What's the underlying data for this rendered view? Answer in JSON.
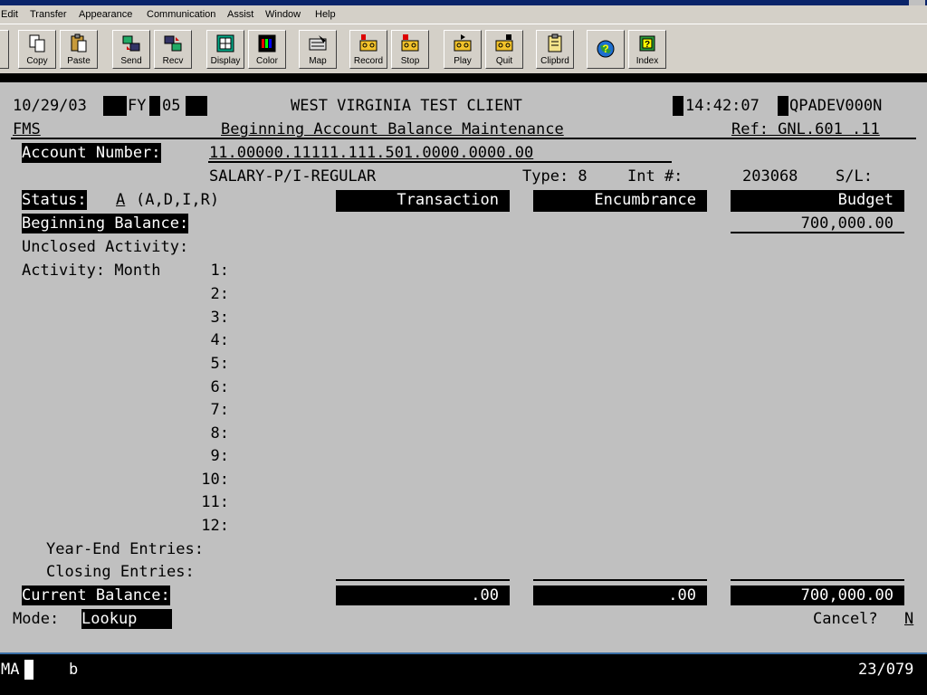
{
  "menu": [
    "Edit",
    "Transfer",
    "Appearance",
    "Communication",
    "Assist",
    "Window",
    "Help"
  ],
  "toolbar": [
    {
      "label": "Copy",
      "icon": "copy-icon"
    },
    {
      "label": "Paste",
      "icon": "paste-icon"
    },
    {
      "label": "Send",
      "icon": "send-icon"
    },
    {
      "label": "Recv",
      "icon": "receive-icon"
    },
    {
      "label": "Display",
      "icon": "display-icon"
    },
    {
      "label": "Color",
      "icon": "color-icon"
    },
    {
      "label": "Map",
      "icon": "map-icon"
    },
    {
      "label": "Record",
      "icon": "record-icon"
    },
    {
      "label": "Stop",
      "icon": "stop-icon"
    },
    {
      "label": "Play",
      "icon": "play-icon"
    },
    {
      "label": "Quit",
      "icon": "quit-icon"
    },
    {
      "label": "Clipbrd",
      "icon": "clipboard-icon"
    },
    {
      "label": "",
      "icon": "help-globe-icon"
    },
    {
      "label": "Index",
      "icon": "index-icon"
    }
  ],
  "header": {
    "date": "10/29/03",
    "fy_label": "FY",
    "fy": "05",
    "client": "WEST VIRGINIA TEST CLIENT",
    "time": "14:42:07",
    "user": "QPADEV000N",
    "system": "FMS",
    "screen_title": "Beginning Account Balance Maintenance",
    "ref": "Ref: GNL.601 .11"
  },
  "account": {
    "label": "Account Number:",
    "number": "11.00000.11111.111.501.0000.0000.00",
    "description": "SALARY-P/I-REGULAR",
    "type": "Type: 8",
    "int_label": "Int #:",
    "int_value": "203068",
    "sl_label": "S/L:"
  },
  "status": {
    "label": "Status:",
    "value": "A",
    "options": "(A,D,I,R)"
  },
  "columns": {
    "transaction": "Transaction",
    "encumbrance": "Encumbrance",
    "budget": "Budget"
  },
  "rows": {
    "beginning_balance": "Beginning Balance:",
    "beginning_budget": "700,000.00",
    "unclosed": "Unclosed Activity:",
    "activity": "Activity: Month",
    "months": [
      "1:",
      "2:",
      "3:",
      "4:",
      "5:",
      "6:",
      "7:",
      "8:",
      "9:",
      "10:",
      "11:",
      "12:"
    ],
    "year_end": "Year-End Entries:",
    "closing": "Closing Entries:",
    "current_balance": "Current Balance:",
    "current_transaction": ".00",
    "current_encumbrance": ".00",
    "current_budget": "700,000.00"
  },
  "footer": {
    "mode_label": "Mode:",
    "mode_value": "Lookup",
    "cancel_label": "Cancel?",
    "cancel_value": "N"
  },
  "statusline": {
    "session": "MA",
    "indicator": "b",
    "cursor_pos": "23/079"
  }
}
